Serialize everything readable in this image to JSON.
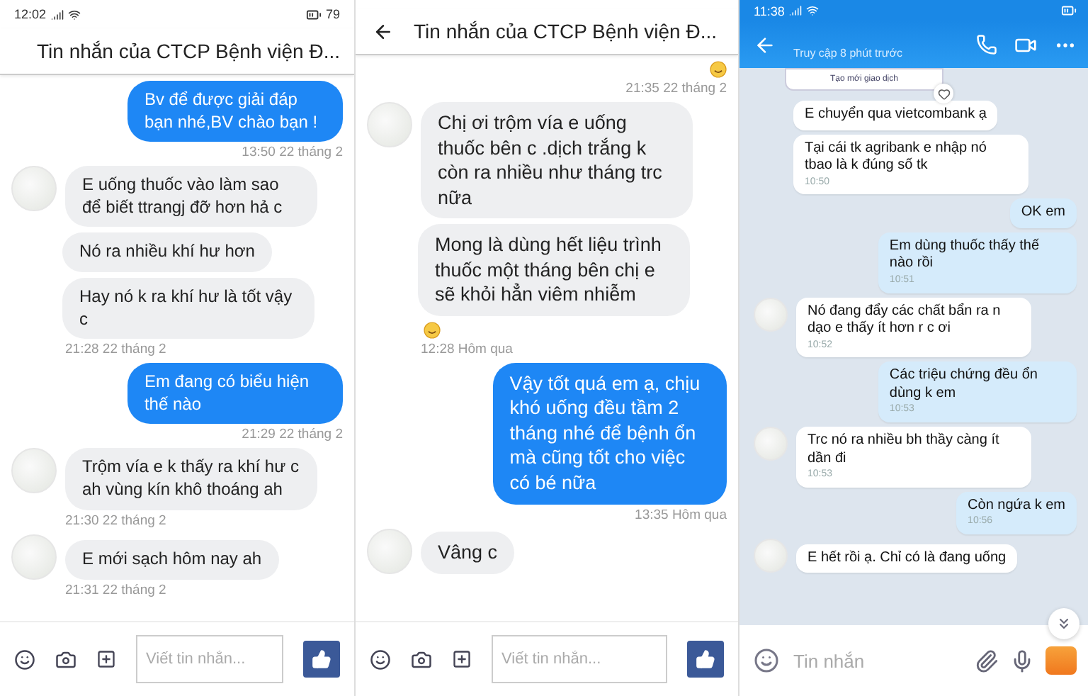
{
  "panels": [
    {
      "kind": "messenger",
      "status": {
        "time": "12:02",
        "battery": "79"
      },
      "title": "Tin nhắn của CTCP Bệnh viện Đ...",
      "items": [
        {
          "kind": "sent",
          "text": "Bv để được giải đáp bạn nhé,BV chào bạn !"
        },
        {
          "kind": "time",
          "text": "13:50 22 tháng 2"
        },
        {
          "kind": "received",
          "avatar": true,
          "text": "E uống thuốc vào làm sao để biết ttrangj đỡ hơn hả c"
        },
        {
          "kind": "received",
          "avatar": false,
          "text": "Nó ra nhiều khí hư hơn"
        },
        {
          "kind": "received",
          "avatar": false,
          "text": "Hay nó k ra khí hư là tốt vậy c"
        },
        {
          "kind": "time",
          "text": "21:28 22 tháng 2"
        },
        {
          "kind": "sent",
          "text": "Em đang có biểu hiện thế nào"
        },
        {
          "kind": "time",
          "text": "21:29 22 tháng 2"
        },
        {
          "kind": "received",
          "avatar": true,
          "text": "Trộm vía e k thấy ra khí hư c ah vùng kín khô thoáng ah"
        },
        {
          "kind": "time",
          "text": "21:30 22 tháng 2"
        },
        {
          "kind": "received",
          "avatar": true,
          "text": "E mới sạch hôm nay ah"
        },
        {
          "kind": "time",
          "text": "21:31 22 tháng 2"
        }
      ],
      "composer": {
        "placeholder": "Viết tin nhắn..."
      }
    },
    {
      "kind": "messenger",
      "title": "Tin nhắn của CTCP Bệnh viện Đ...",
      "items": [
        {
          "kind": "sticker"
        },
        {
          "kind": "time",
          "text": "21:35 22 tháng 2"
        },
        {
          "kind": "received",
          "avatar": true,
          "text": "Chị ơi trộm vía e uống thuốc bên c .dịch trắng k còn ra nhiều như tháng trc nữa"
        },
        {
          "kind": "received",
          "avatar": false,
          "text": "Mong là dùng hết liệu trình thuốc một tháng bên chị e sẽ khỏi hẳn  viêm nhiễm"
        },
        {
          "kind": "sticker"
        },
        {
          "kind": "time",
          "text": "12:28 Hôm qua"
        },
        {
          "kind": "sent",
          "text": "Vậy tốt quá em ạ, chịu khó uống đều tầm 2 tháng nhé để bệnh ổn mà cũng tốt cho việc có bé nữa"
        },
        {
          "kind": "time",
          "text": "13:35 Hôm qua"
        },
        {
          "kind": "received",
          "avatar": true,
          "text": "Vâng c"
        }
      ],
      "composer": {
        "placeholder": "Viết tin nhắn..."
      }
    },
    {
      "kind": "zalo",
      "status": {
        "time": "11:38"
      },
      "subtitle": "Truy cập 8 phút trước",
      "items": [
        {
          "kind": "card",
          "text": "Tạo mới giao dịch"
        },
        {
          "kind": "received",
          "avatar": false,
          "text": "E chuyển qua vietcombank ạ"
        },
        {
          "kind": "received",
          "avatar": false,
          "text": "Tại cái tk agribank e nhập nó tbao là k đúng số tk",
          "time": "10:50"
        },
        {
          "kind": "sent",
          "text": "OK em"
        },
        {
          "kind": "sent",
          "text": "Em dùng thuốc thấy thế nào rồi",
          "time": "10:51"
        },
        {
          "kind": "received",
          "avatar": true,
          "text": "Nó đang đẩy các chất bẩn ra n dạo e thấy ít hơn r c ơi",
          "time": "10:52"
        },
        {
          "kind": "sent",
          "text": "Các triệu chứng đều ổn dùng k em",
          "time": "10:53"
        },
        {
          "kind": "received",
          "avatar": true,
          "text": "Trc nó ra nhiều bh thầy càng ít dần đi",
          "time": "10:53"
        },
        {
          "kind": "sent",
          "text": "Còn ngứa k em",
          "time": "10:56"
        },
        {
          "kind": "received",
          "avatar": true,
          "text": "E hết rồi ạ. Chỉ có là đang uống"
        }
      ],
      "composer": {
        "placeholder": "Tin nhắn"
      }
    }
  ]
}
